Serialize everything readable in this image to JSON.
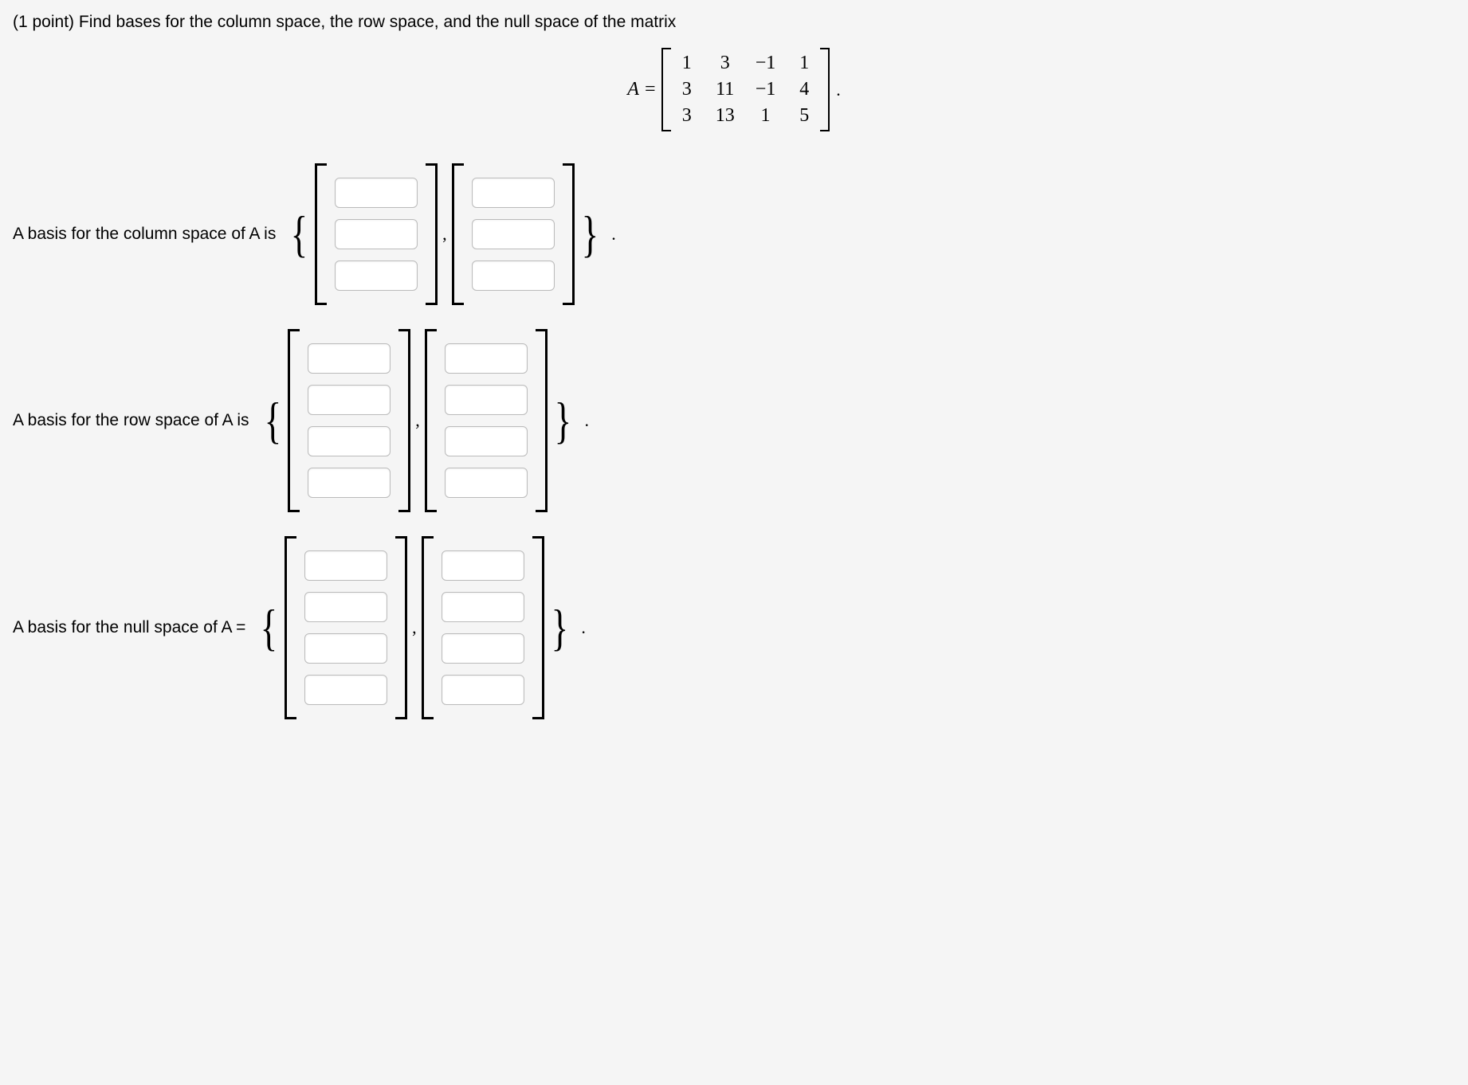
{
  "problem": {
    "points_prefix": "(1 point) ",
    "text": "Find bases for the column space, the row space, and the null space of the matrix"
  },
  "matrix": {
    "lhs": "A =",
    "rows": [
      [
        "1",
        "3",
        "−1",
        "1"
      ],
      [
        "3",
        "11",
        "−1",
        "4"
      ],
      [
        "3",
        "13",
        "1",
        "5"
      ]
    ],
    "trailing": "."
  },
  "answers": {
    "col": {
      "label": "A basis for the column space of A is",
      "rows": 3,
      "vecs": 2
    },
    "row": {
      "label": "A basis for the row space of A is",
      "rows": 4,
      "vecs": 2
    },
    "null": {
      "label": "A basis for the null space of A =",
      "rows": 4,
      "vecs": 2
    }
  },
  "punct": {
    "comma": ",",
    "period": "."
  }
}
